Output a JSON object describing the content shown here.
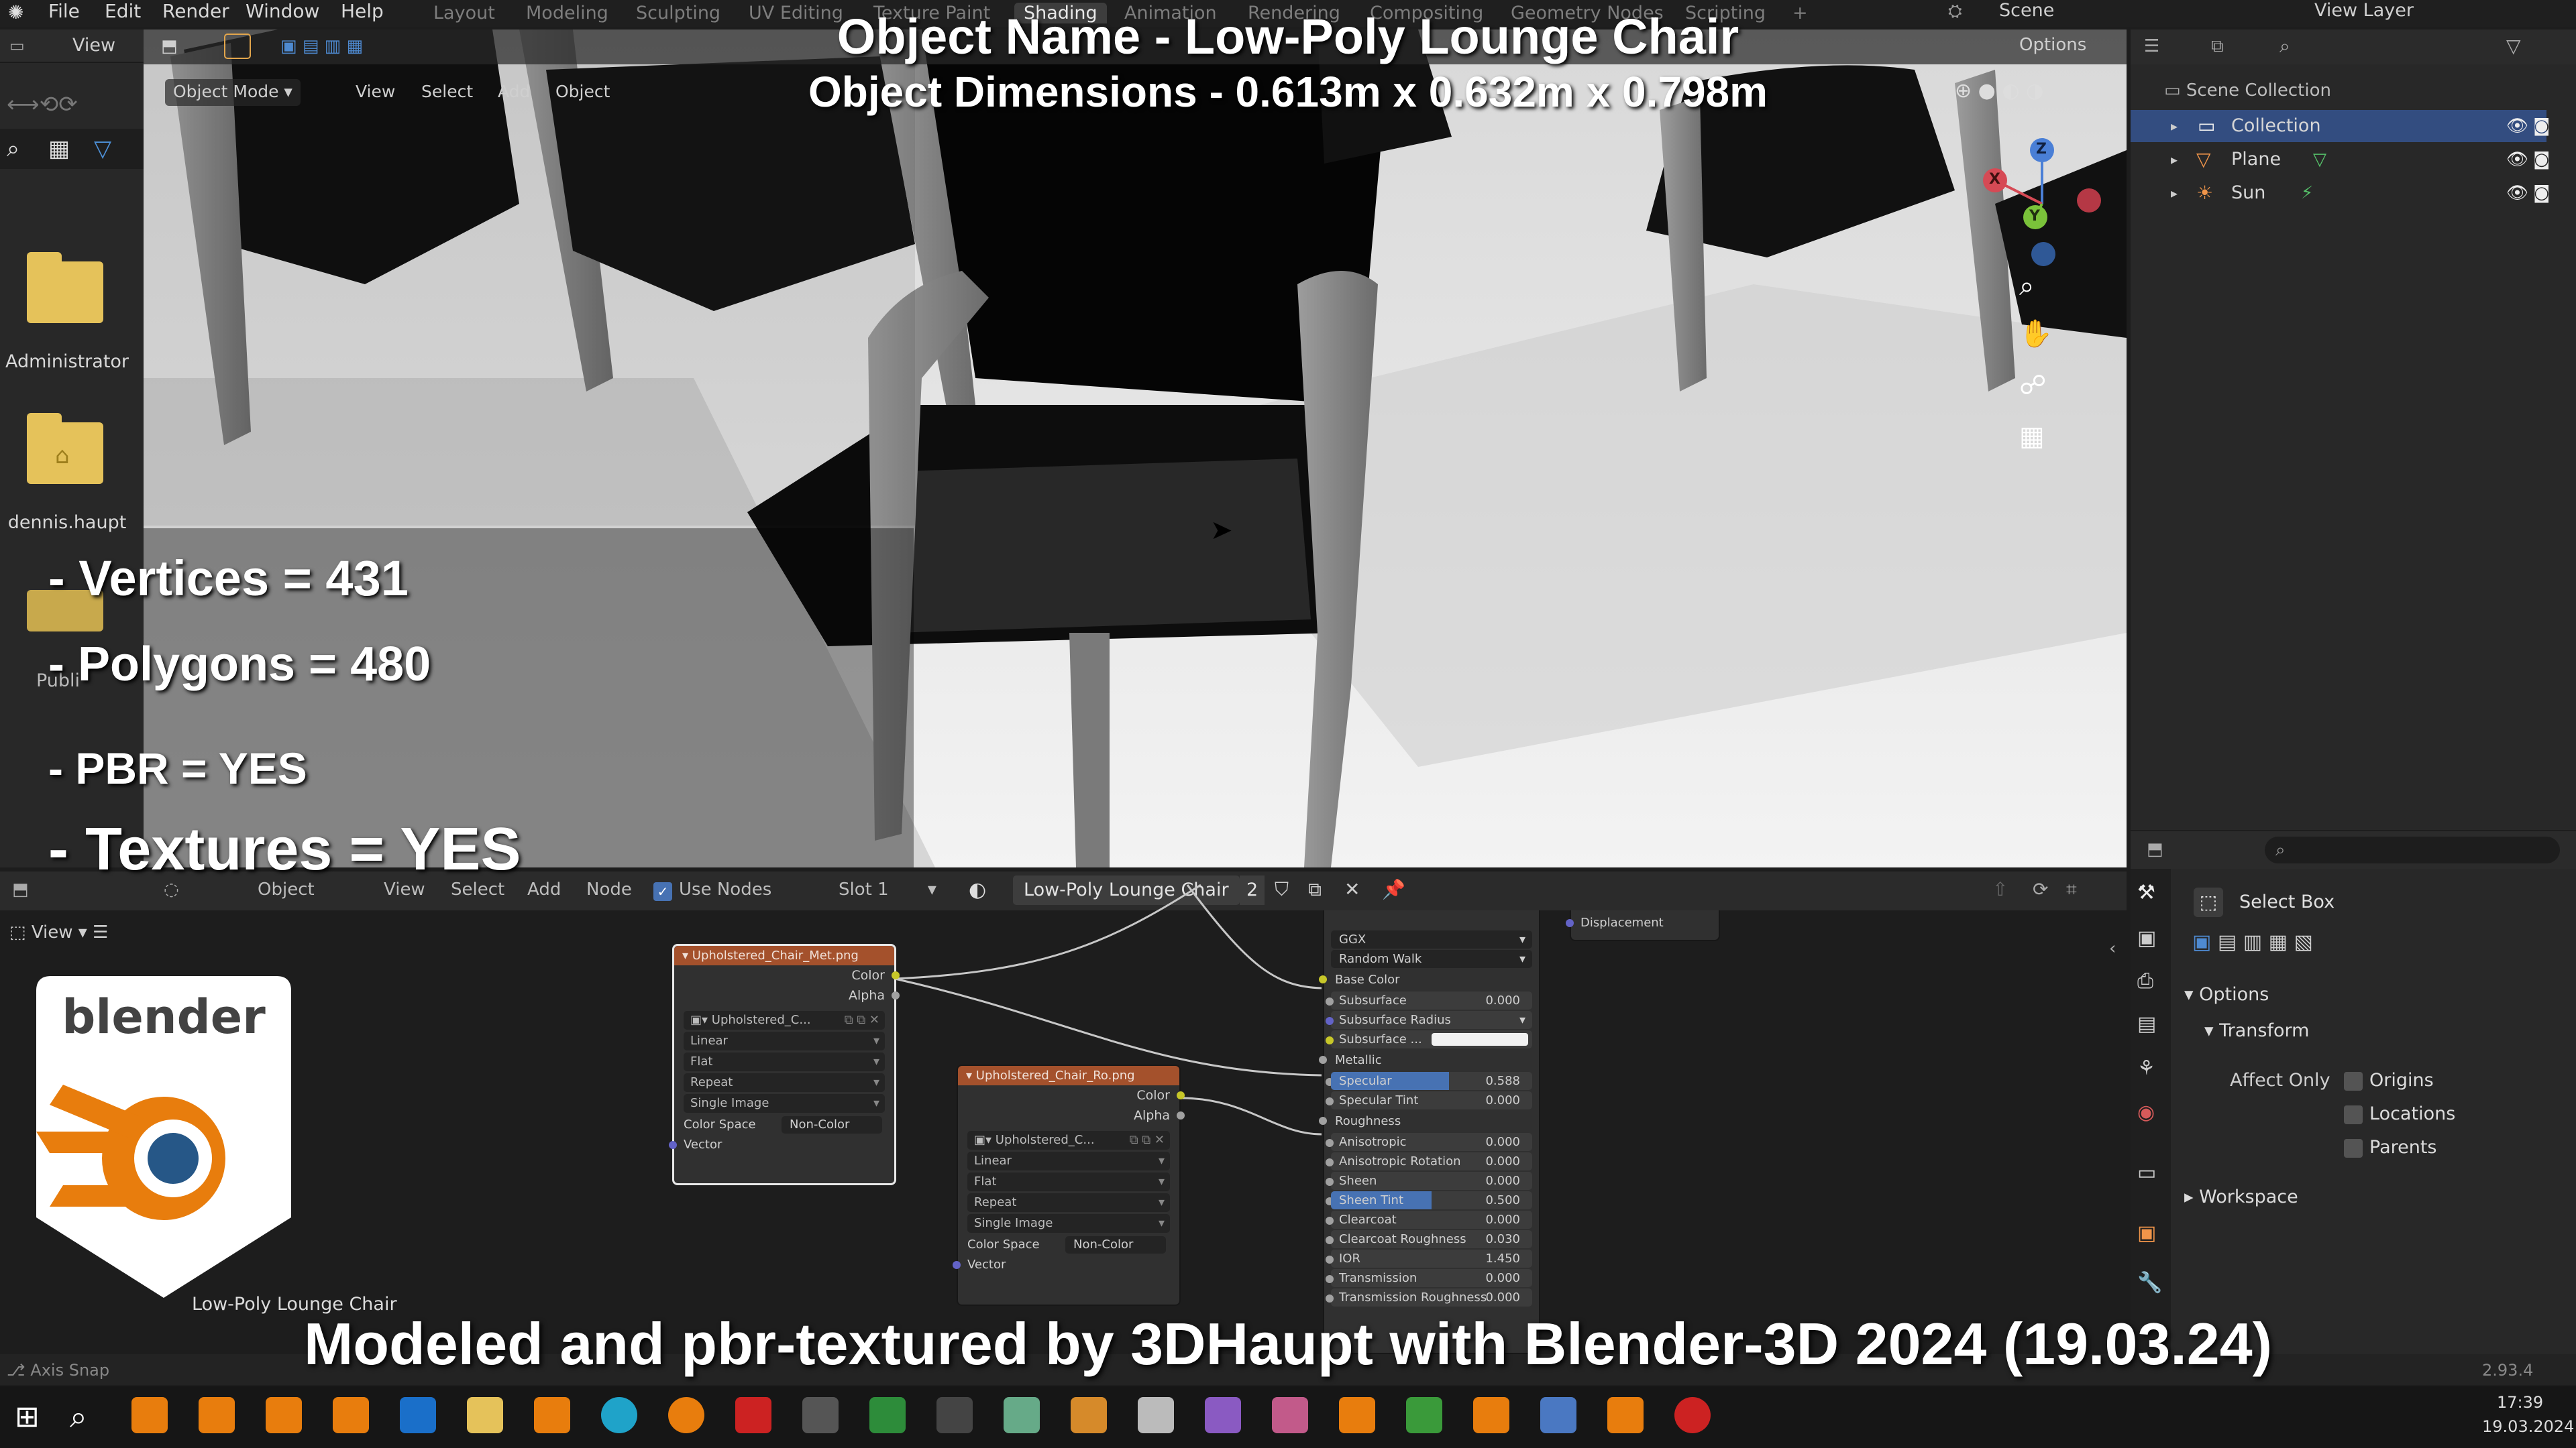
{
  "topbar": {
    "menus": [
      "File",
      "Edit",
      "Render",
      "Window",
      "Help"
    ],
    "workspaces": [
      "Layout",
      "Modeling",
      "Sculpting",
      "UV Editing",
      "Texture Paint",
      "Shading",
      "Animation",
      "Rendering",
      "Compositing",
      "Geometry Nodes",
      "Scripting"
    ],
    "active_workspace": "Shading",
    "scene_label": "Scene",
    "view_layer_label": "View Layer"
  },
  "file_browser": {
    "view_label": "View",
    "folders": [
      {
        "name": "Administrator",
        "icon": "folder-icon"
      },
      {
        "name": "dennis.haupt",
        "icon": "home-folder-icon"
      },
      {
        "name": "Publi",
        "icon": "folder-icon"
      }
    ]
  },
  "viewport": {
    "mode": "Object Mode",
    "menu": [
      "View",
      "Select",
      "Add",
      "Object"
    ],
    "options_label": "Options",
    "gizmo_axes": [
      "X",
      "Y",
      "Z"
    ]
  },
  "overlay": {
    "object_name_line": "Object Name - Low-Poly Lounge Chair",
    "dimensions_line": "Object Dimensions -  0.613m x 0.632m x 0.798m",
    "stats": [
      "- Vertices = 431",
      "- Polygons = 480",
      "- PBR =  YES",
      "- Textures = YES"
    ],
    "footer": "Modeled and pbr-textured by 3DHaupt with Blender-3D 2024 (19.03.24)",
    "logo_text": "blender"
  },
  "outliner": {
    "title": "Scene Collection",
    "items": [
      {
        "name": "Collection",
        "icon": "collection-icon",
        "selected": true
      },
      {
        "name": "Plane",
        "icon": "mesh-icon",
        "selected": false
      },
      {
        "name": "Sun",
        "icon": "light-icon",
        "selected": false
      }
    ]
  },
  "node_editor": {
    "editor_type": "Object",
    "menu": [
      "View",
      "Select",
      "Add",
      "Node"
    ],
    "use_nodes_label": "Use Nodes",
    "slot_label": "Slot 1",
    "material_name": "Low-Poly Lounge Chair",
    "user_count": "2",
    "view_label": "View",
    "object_label": "Low-Poly Lounge Chair",
    "node1": {
      "title": "Upholstered_Chair_Met.png",
      "outputs": [
        "Color",
        "Alpha"
      ],
      "image_name": "Upholstered_C...",
      "interpolation": "Linear",
      "projection": "Flat",
      "extension": "Repeat",
      "source": "Single Image",
      "color_space_label": "Color Space",
      "color_space_value": "Non-Color",
      "input": "Vector"
    },
    "node2": {
      "title": "Upholstered_Chair_Ro.png",
      "outputs": [
        "Color",
        "Alpha"
      ],
      "image_name": "Upholstered_C...",
      "interpolation": "Linear",
      "projection": "Flat",
      "extension": "Repeat",
      "source": "Single Image",
      "color_space_label": "Color Space",
      "color_space_value": "Non-Color",
      "input": "Vector"
    },
    "bsdf": {
      "distribution": "GGX",
      "subsurface_method": "Random Walk",
      "rows": [
        {
          "label": "Base Color",
          "value": "",
          "type": "socket"
        },
        {
          "label": "Subsurface",
          "value": "0.000",
          "type": "field"
        },
        {
          "label": "Subsurface Radius",
          "value": "",
          "type": "dropdown"
        },
        {
          "label": "Subsurface ...",
          "value": "",
          "type": "color"
        },
        {
          "label": "Metallic",
          "value": "",
          "type": "socket"
        },
        {
          "label": "Specular",
          "value": "0.588",
          "type": "slider",
          "fill": 0.588
        },
        {
          "label": "Specular Tint",
          "value": "0.000",
          "type": "field"
        },
        {
          "label": "Roughness",
          "value": "",
          "type": "socket"
        },
        {
          "label": "Anisotropic",
          "value": "0.000",
          "type": "field"
        },
        {
          "label": "Anisotropic Rotation",
          "value": "0.000",
          "type": "field"
        },
        {
          "label": "Sheen",
          "value": "0.000",
          "type": "field"
        },
        {
          "label": "Sheen Tint",
          "value": "0.500",
          "type": "slider",
          "fill": 0.5
        },
        {
          "label": "Clearcoat",
          "value": "0.000",
          "type": "field"
        },
        {
          "label": "Clearcoat Roughness",
          "value": "0.030",
          "type": "field"
        },
        {
          "label": "IOR",
          "value": "1.450",
          "type": "field"
        },
        {
          "label": "Transmission",
          "value": "0.000",
          "type": "field"
        },
        {
          "label": "Transmission Roughness",
          "value": "0.000",
          "type": "field"
        }
      ]
    },
    "output_node": {
      "input": "Displacement"
    }
  },
  "properties": {
    "tool_name": "Select Box",
    "options_label": "Options",
    "transform_label": "Transform",
    "affect_only_label": "Affect Only",
    "checkboxes": [
      "Origins",
      "Locations",
      "Parents"
    ],
    "workspace_label": "Workspace"
  },
  "statusbar": {
    "left": "Axis Snap",
    "version": "2.93.4"
  },
  "taskbar": {
    "time": "17:39",
    "date": "19.03.2024"
  },
  "colors": {
    "accent_blue": "#4772b3",
    "node_header_image": "#a4512c",
    "blender_orange": "#e87d0d",
    "blender_blue": "#265787"
  }
}
